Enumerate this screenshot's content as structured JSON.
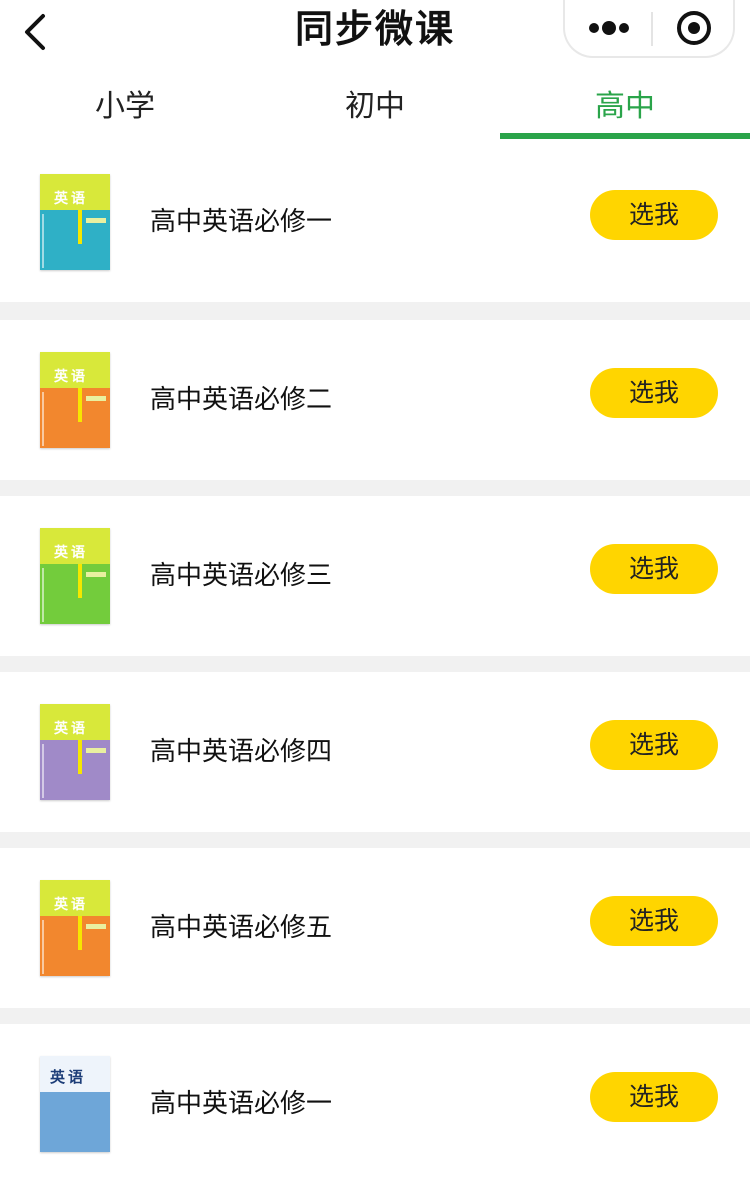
{
  "header": {
    "title": "同步微课",
    "back_icon": "chevron-left-icon",
    "more_icon": "more-dots-icon",
    "close_icon": "target-circle-icon"
  },
  "tabs": [
    {
      "label": "小学",
      "active": false
    },
    {
      "label": "初中",
      "active": false
    },
    {
      "label": "高中",
      "active": true
    }
  ],
  "colors": {
    "accent_green": "#2aa44a",
    "button_yellow": "#ffd500",
    "separator": "#f1f1f1"
  },
  "books": [
    {
      "name": "高中英语必修一",
      "button": "选我",
      "cover_color": "#2fb0c6",
      "cover_title": "英语"
    },
    {
      "name": "高中英语必修二",
      "button": "选我",
      "cover_color": "#f2872e",
      "cover_title": "英语"
    },
    {
      "name": "高中英语必修三",
      "button": "选我",
      "cover_color": "#73cc3c",
      "cover_title": "英语"
    },
    {
      "name": "高中英语必修四",
      "button": "选我",
      "cover_color": "#a08ac8",
      "cover_title": "英语"
    },
    {
      "name": "高中英语必修五",
      "button": "选我",
      "cover_color": "#f2872e",
      "cover_title": "英语"
    },
    {
      "name": "高中英语必修一",
      "button": "选我",
      "cover_color": "#6ea6d8",
      "cover_title": "英语"
    }
  ]
}
